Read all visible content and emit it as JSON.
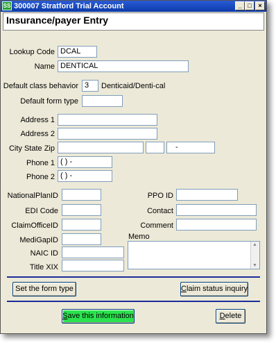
{
  "window": {
    "title": "300007 Stratford Trial Account",
    "icon_text": "SS",
    "minimize_glyph": "_",
    "maximize_glyph": "□",
    "close_glyph": "×"
  },
  "header": {
    "title": "Insurance/payer Entry"
  },
  "form": {
    "lookup_code": {
      "label": "Lookup Code",
      "value": "DCAL"
    },
    "name": {
      "label": "Name",
      "value": "DENTICAL"
    },
    "default_class_behavior": {
      "label": "Default class behavior",
      "value": "3",
      "description": "Denticaid/Denti-cal"
    },
    "default_form_type": {
      "label": "Default form type",
      "value": ""
    },
    "address1": {
      "label": "Address 1",
      "value": ""
    },
    "address2": {
      "label": "Address 2",
      "value": ""
    },
    "city_state_zip": {
      "label": "City State  Zip",
      "city": "",
      "state": "",
      "zip": " -"
    },
    "phone1": {
      "label": "Phone 1",
      "value": "(  )   -"
    },
    "phone2": {
      "label": "Phone 2",
      "value": "(  )   -"
    },
    "national_plan_id": {
      "label": "NationalPlanID",
      "value": ""
    },
    "edi_code": {
      "label": "EDI Code",
      "value": ""
    },
    "claim_office_id": {
      "label": "ClaimOfficeID",
      "value": ""
    },
    "medigap_id": {
      "label": "MediGapID",
      "value": ""
    },
    "naic_id": {
      "label": "NAIC ID",
      "value": ""
    },
    "title_xix": {
      "label": "Title XIX",
      "value": ""
    },
    "ppo_id": {
      "label": "PPO ID",
      "value": ""
    },
    "contact": {
      "label": "Contact",
      "value": ""
    },
    "comment": {
      "label": "Comment",
      "value": ""
    },
    "memo": {
      "label": "Memo",
      "value": ""
    }
  },
  "buttons": {
    "set_form_type": "Set the form type",
    "claim_status_u": "C",
    "claim_status_rest": "laim status inquiry",
    "save_u": "S",
    "save_rest": "ave this information",
    "delete_u": "D",
    "delete_rest": "elete"
  },
  "colors": {
    "titlebar": "#0b3aa8",
    "window_bg": "#ece9d8",
    "separator": "#1a2b9b",
    "save_button": "#2be24e"
  }
}
